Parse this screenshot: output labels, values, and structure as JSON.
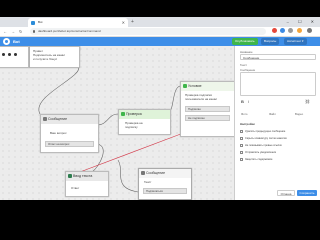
{
  "browser": {
    "tab_title": "Bot",
    "new_tab": "+",
    "window_controls": "– ☐ ✕",
    "tab_close": "✕",
    "url": "dashboard.puzzlebot.top/constructor/command",
    "nav": {
      "back": "←",
      "forward": "→",
      "reload": "↻"
    }
  },
  "app": {
    "project_name": "Bot",
    "buttons": {
      "publish": "Опубликовать",
      "help": "Вопросы",
      "account": "Ассистент ▾"
    }
  },
  "canvas": {
    "node_a": {
      "text_1": "Привет",
      "text_2": "Подпишитесь на канал",
      "text_3": "и получите бонус"
    },
    "node_b": {
      "title": "Сообщение",
      "text": "Ваш вопрос",
      "button": "Ответ на вопрос"
    },
    "node_c": {
      "title": "Проверка",
      "text_1": "Проверка на",
      "text_2": "подписку"
    },
    "node_d": {
      "title": "Условие",
      "text_1": "Проверка подписки",
      "text_2": "пользователя на канал",
      "button_1": "Подписан",
      "button_2": "Не подписан"
    },
    "node_e": {
      "title": "Сообщение",
      "text": "Текст",
      "button": "Подписаться"
    },
    "node_f": {
      "title": "Ввод текста",
      "text": "Ответ"
    }
  },
  "panel": {
    "name_label": "Название",
    "name_value": "Сообщение",
    "text_label": "Текст",
    "text_label_2": "Сообщение",
    "tools": {
      "bold": "B",
      "italic": "I",
      "link": "⛓"
    },
    "media": {
      "photo": "Фото",
      "file": "Файл",
      "video": "Видео"
    },
    "options_title": "Настройки",
    "options": [
      "Удалить предыдущее сообщение",
      "Скрыть клавиатуру после нажатия",
      "Не показывать превью ссылок",
      "Отправлять уведомления",
      "Защитить содержимое"
    ],
    "cancel": "Отмена",
    "save": "Сохранить"
  },
  "colors": {
    "header": "#3d8ee8",
    "publish": "#3fb64b",
    "edge_red": "#d33a4a"
  }
}
